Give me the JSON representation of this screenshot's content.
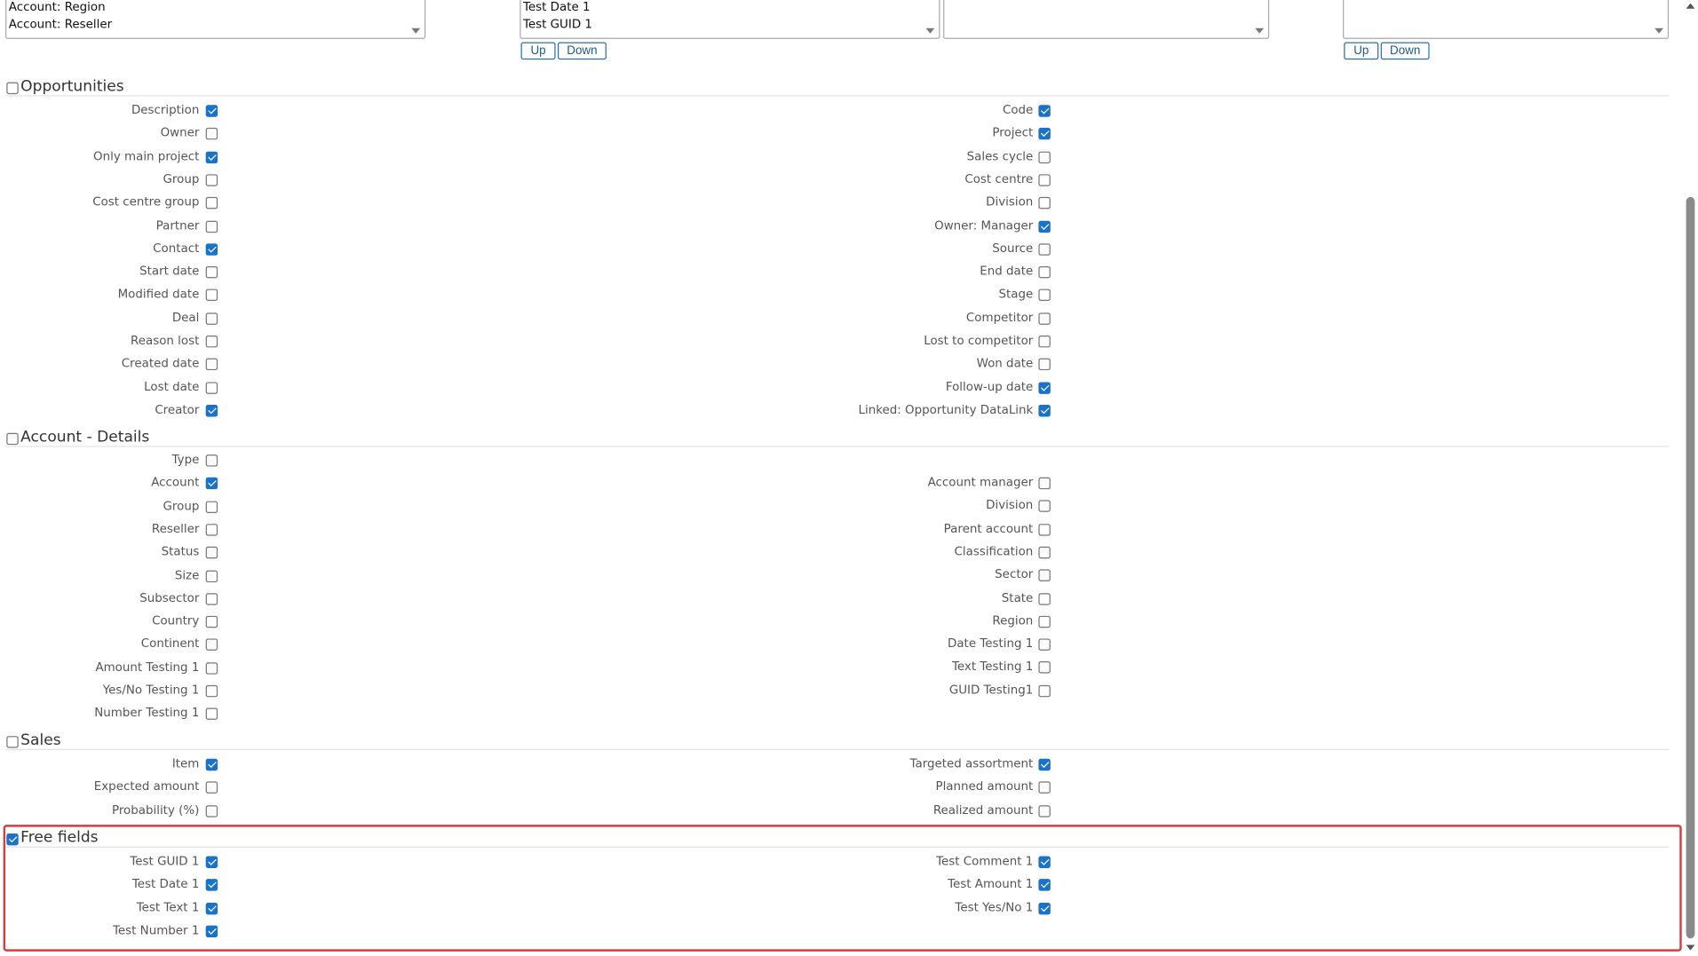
{
  "top_lists": {
    "list1": {
      "options": [
        "Account: Region",
        "Account: Reseller"
      ]
    },
    "list2": {
      "options": [
        "Test Date 1",
        "Test GUID 1"
      ]
    },
    "list3": {
      "options": []
    },
    "list4": {
      "options": []
    },
    "up_label": "Up",
    "down_label": "Down"
  },
  "sections": {
    "opportunities": {
      "title": "Opportunities",
      "checked": false,
      "left": [
        {
          "label": "Description",
          "checked": true
        },
        {
          "label": "Owner",
          "checked": false
        },
        {
          "label": "Only main project",
          "checked": true
        },
        {
          "label": "Group",
          "checked": false
        },
        {
          "label": "Cost centre group",
          "checked": false
        },
        {
          "label": "Partner",
          "checked": false
        },
        {
          "label": "Contact",
          "checked": true
        },
        {
          "label": "Start date",
          "checked": false
        },
        {
          "label": "Modified date",
          "checked": false
        },
        {
          "label": "Deal",
          "checked": false
        },
        {
          "label": "Reason lost",
          "checked": false
        },
        {
          "label": "Created date",
          "checked": false
        },
        {
          "label": "Lost date",
          "checked": false
        },
        {
          "label": "Creator",
          "checked": true
        }
      ],
      "right": [
        {
          "label": "Code",
          "checked": true
        },
        {
          "label": "Project",
          "checked": true
        },
        {
          "label": "Sales cycle",
          "checked": false
        },
        {
          "label": "Cost centre",
          "checked": false
        },
        {
          "label": "Division",
          "checked": false
        },
        {
          "label": "Owner: Manager",
          "checked": true
        },
        {
          "label": "Source",
          "checked": false
        },
        {
          "label": "End date",
          "checked": false
        },
        {
          "label": "Stage",
          "checked": false
        },
        {
          "label": "Competitor",
          "checked": false
        },
        {
          "label": "Lost to competitor",
          "checked": false
        },
        {
          "label": "Won date",
          "checked": false
        },
        {
          "label": "Follow-up date",
          "checked": true
        },
        {
          "label": "Linked: Opportunity DataLink",
          "checked": true
        }
      ]
    },
    "account_details": {
      "title": "Account - Details",
      "checked": false,
      "left": [
        {
          "label": "Type",
          "checked": false
        },
        {
          "label": "Account",
          "checked": true
        },
        {
          "label": "Group",
          "checked": false
        },
        {
          "label": "Reseller",
          "checked": false
        },
        {
          "label": "Status",
          "checked": false
        },
        {
          "label": "Size",
          "checked": false
        },
        {
          "label": "Subsector",
          "checked": false
        },
        {
          "label": "Country",
          "checked": false
        },
        {
          "label": "Continent",
          "checked": false
        },
        {
          "label": "Amount Testing 1",
          "checked": false
        },
        {
          "label": "Yes/No Testing 1",
          "checked": false
        },
        {
          "label": "Number Testing 1",
          "checked": false
        }
      ],
      "right": [
        {
          "label": "Account manager",
          "checked": false
        },
        {
          "label": "Division",
          "checked": false
        },
        {
          "label": "Parent account",
          "checked": false
        },
        {
          "label": "Classification",
          "checked": false
        },
        {
          "label": "Sector",
          "checked": false
        },
        {
          "label": "State",
          "checked": false
        },
        {
          "label": "Region",
          "checked": false
        },
        {
          "label": "Date Testing 1",
          "checked": false
        },
        {
          "label": "Text Testing 1",
          "checked": false
        },
        {
          "label": "GUID Testing1",
          "checked": false
        }
      ]
    },
    "sales": {
      "title": "Sales",
      "checked": false,
      "left": [
        {
          "label": "Item",
          "checked": true
        },
        {
          "label": "Expected amount",
          "checked": false
        },
        {
          "label": "Probability (%)",
          "checked": false
        }
      ],
      "right": [
        {
          "label": "Targeted assortment",
          "checked": true
        },
        {
          "label": "Planned amount",
          "checked": false
        },
        {
          "label": "Realized amount",
          "checked": false
        }
      ]
    },
    "free_fields": {
      "title": "Free fields",
      "checked": true,
      "left": [
        {
          "label": "Test GUID 1",
          "checked": true
        },
        {
          "label": "Test Date 1",
          "checked": true
        },
        {
          "label": "Test Text 1",
          "checked": true
        },
        {
          "label": "Test Number 1",
          "checked": true
        }
      ],
      "right": [
        {
          "label": "Test Comment 1",
          "checked": true
        },
        {
          "label": "Test Amount 1",
          "checked": true
        },
        {
          "label": "Test Yes/No 1",
          "checked": true
        }
      ]
    }
  },
  "colors": {
    "checkbox_checked": "#1a73c9",
    "highlight_frame": "#d33d44",
    "button_border": "#2a70a8"
  }
}
